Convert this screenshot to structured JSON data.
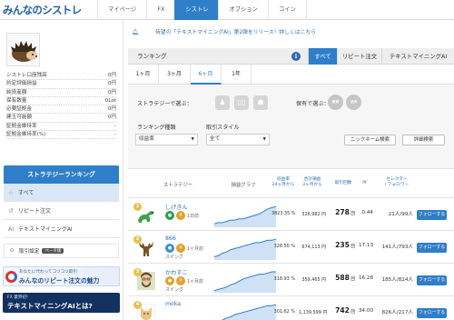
{
  "header": {
    "logo": "みんなのシストレ",
    "nav": [
      "マイページ",
      "FX",
      "シストレ",
      "オプション",
      "コイン"
    ],
    "nav_active_index": 2
  },
  "sidebar": {
    "stats": [
      {
        "label": "シストレ口座残高",
        "value": "0円"
      },
      {
        "label": "約定評価損益",
        "value": "0円"
      },
      {
        "label": "純資産額",
        "value": "0円"
      },
      {
        "label": "保有数量",
        "value": "0Lot"
      },
      {
        "label": "必要証拠金",
        "value": "0円"
      },
      {
        "label": "建玉可能額",
        "value": "0円"
      },
      {
        "label": "証拠金維持率",
        "value": "-"
      },
      {
        "label": "証拠金維持率(%)",
        "value": "-"
      }
    ],
    "ranking_button": "ストラテジーランキング",
    "menu": [
      {
        "icon": "☆",
        "label": "すべて"
      },
      {
        "icon": "↺",
        "label": "リピート注文"
      },
      {
        "icon": "AI",
        "label": "テキストマイニングAI"
      }
    ],
    "tool": {
      "label": "取引設定",
      "tag": "ベータ版"
    },
    "banner1": {
      "small": "あなたに代わってコツコツ取引",
      "big": "みんなのリピート注文の魅力"
    },
    "banner2": {
      "small": "FX 業界初!",
      "big": "テキストマイニングAIとは?"
    }
  },
  "main": {
    "notice": "待望の「テキストマイニングAI」第2弾をリリース！詳しくはこちら",
    "ranking_title": "ランキング",
    "ranking_tabs": [
      "すべて",
      "リピート注文",
      "テキストマイニングAI"
    ],
    "ranking_tab_active": 0,
    "period_tabs": [
      "1ヶ月",
      "3ヶ月",
      "6ヶ月",
      "1年"
    ],
    "period_active": 2,
    "filters": {
      "strategy_label": "ストラテジーで選ぶ：",
      "rule_label": "保有で選ぶ：",
      "rank_type_label": "ランキング種類",
      "rank_type_value": "収益率",
      "trade_style_label": "取引スタイル",
      "trade_style_value": "全て",
      "nickname_button": "ニックネーム検索",
      "detail_button": "詳細検索",
      "style_icons": [
        "新規",
        "決済"
      ]
    },
    "table_headers": {
      "strategy": "ストラテジー",
      "graph": "損益グラフ",
      "return_rate": "収益率",
      "return_rate_sub": "24ヶ月から",
      "total_pl": "合計損益",
      "total_pl_sub": "3ヶ月から",
      "trade_count": "取引回数",
      "pf": "PF",
      "selector": "セレクター",
      "selector_sub": "/ フォロワー"
    },
    "rows": [
      {
        "rank": "1",
        "name": "しげきん",
        "meta": "1日前",
        "sub": "",
        "color": "#2e9e4a",
        "return": "3823.35 %",
        "total": "326,982 円",
        "trades": "278",
        "pf": "0.44",
        "selectors": "21人/99人",
        "follow": "フォローする",
        "spark": [
          2,
          3,
          3,
          4,
          5,
          5,
          6,
          6,
          7,
          8,
          9,
          10,
          12,
          14,
          15,
          16
        ]
      },
      {
        "rank": "2",
        "name": "866",
        "meta": "1ヶ月前",
        "sub": "スイング",
        "color": "#3a8fd1",
        "return": "328.50 %",
        "total": "674,113 円",
        "trades": "235",
        "pf": "17.13",
        "selectors": "141人/793人",
        "follow": "フォローする",
        "spark": [
          2,
          3,
          5,
          6,
          8,
          9,
          10,
          11,
          12,
          13,
          14,
          14,
          15,
          16,
          16,
          17
        ]
      },
      {
        "rank": "3",
        "name": "かわすこ",
        "meta": "1ヶ月前",
        "sub": "スイング",
        "color": "#e3a12a",
        "return": "318.93 %",
        "total": "359,465 円",
        "trades": "588",
        "pf": "16.28",
        "selectors": "185人/824人",
        "follow": "フォローする",
        "spark": [
          1,
          2,
          3,
          4,
          6,
          7,
          9,
          11,
          12,
          13,
          14,
          15,
          15,
          16,
          17,
          17
        ]
      },
      {
        "rank": "4",
        "name": "moka",
        "meta": "",
        "sub": "",
        "color": "#8b5bd1",
        "return": "301.62 %",
        "total": "1,139,599 円",
        "trades": "742",
        "pf": "34.00",
        "selectors": "826人/217人",
        "follow": "フォローする",
        "spark": [
          1,
          3,
          4,
          6,
          7,
          9,
          10,
          11,
          12,
          13,
          14,
          15,
          16,
          17,
          17,
          18
        ]
      }
    ]
  },
  "colors": {
    "accent": "#2e7ec9",
    "link": "#2e6db5",
    "gold": "#e3c24a"
  }
}
